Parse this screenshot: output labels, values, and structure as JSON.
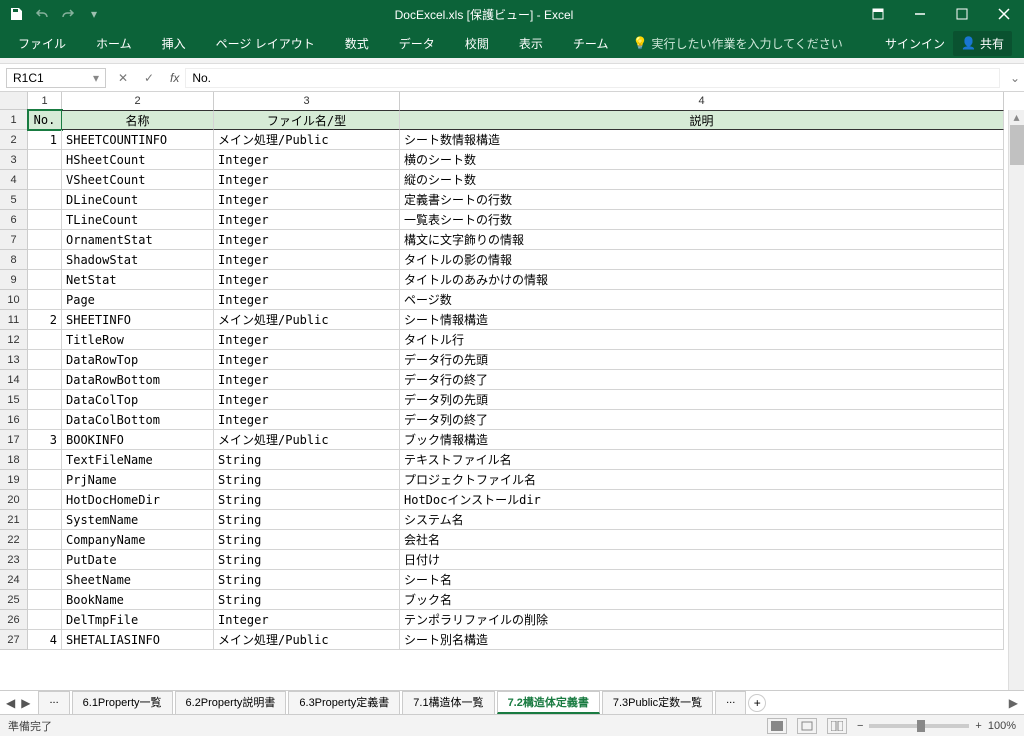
{
  "title": "DocExcel.xls [保護ビュー] - Excel",
  "qat": {
    "save": "save",
    "undo": "undo",
    "redo": "redo"
  },
  "win": {
    "ribbonOpts": "ribbon-options"
  },
  "tabs": [
    "ファイル",
    "ホーム",
    "挿入",
    "ページ レイアウト",
    "数式",
    "データ",
    "校閲",
    "表示",
    "チーム"
  ],
  "tellMe": "実行したい作業を入力してください",
  "signin": "サインイン",
  "share": "共有",
  "nameBox": "R1C1",
  "formulaValue": "No.",
  "colNums": [
    "1",
    "2",
    "3",
    "4"
  ],
  "headers": {
    "no": "No.",
    "name": "名称",
    "file": "ファイル名/型",
    "desc": "説明"
  },
  "rows": [
    {
      "r": "1"
    },
    {
      "r": "2",
      "no": "1",
      "name": "SHEETCOUNTINFO",
      "file": "メイン処理/Public",
      "desc": "シート数情報構造"
    },
    {
      "r": "3",
      "name": "HSheetCount",
      "file": "Integer",
      "desc": "横のシート数"
    },
    {
      "r": "4",
      "name": "VSheetCount",
      "file": "Integer",
      "desc": "縦のシート数"
    },
    {
      "r": "5",
      "name": "DLineCount",
      "file": "Integer",
      "desc": "定義書シートの行数"
    },
    {
      "r": "6",
      "name": "TLineCount",
      "file": "Integer",
      "desc": "一覧表シートの行数"
    },
    {
      "r": "7",
      "name": "OrnamentStat",
      "file": "Integer",
      "desc": "構文に文字飾りの情報"
    },
    {
      "r": "8",
      "name": "ShadowStat",
      "file": "Integer",
      "desc": "タイトルの影の情報"
    },
    {
      "r": "9",
      "name": "NetStat",
      "file": "Integer",
      "desc": "タイトルのあみかけの情報"
    },
    {
      "r": "10",
      "name": "Page",
      "file": "Integer",
      "desc": "ページ数"
    },
    {
      "r": "11",
      "no": "2",
      "name": "SHEETINFO",
      "file": "メイン処理/Public",
      "desc": "シート情報構造"
    },
    {
      "r": "12",
      "name": "TitleRow",
      "file": "Integer",
      "desc": "タイトル行"
    },
    {
      "r": "13",
      "name": "DataRowTop",
      "file": "Integer",
      "desc": "データ行の先頭"
    },
    {
      "r": "14",
      "name": "DataRowBottom",
      "file": "Integer",
      "desc": "データ行の終了"
    },
    {
      "r": "15",
      "name": "DataColTop",
      "file": "Integer",
      "desc": "データ列の先頭"
    },
    {
      "r": "16",
      "name": "DataColBottom",
      "file": "Integer",
      "desc": "データ列の終了"
    },
    {
      "r": "17",
      "no": "3",
      "name": "BOOKINFO",
      "file": "メイン処理/Public",
      "desc": "ブック情報構造"
    },
    {
      "r": "18",
      "name": "TextFileName",
      "file": "String",
      "desc": "テキストファイル名"
    },
    {
      "r": "19",
      "name": "PrjName",
      "file": "String",
      "desc": "プロジェクトファイル名"
    },
    {
      "r": "20",
      "name": "HotDocHomeDir",
      "file": "String",
      "desc": "HotDocインストールdir"
    },
    {
      "r": "21",
      "name": "SystemName",
      "file": "String",
      "desc": "システム名"
    },
    {
      "r": "22",
      "name": "CompanyName",
      "file": "String",
      "desc": "会社名"
    },
    {
      "r": "23",
      "name": "PutDate",
      "file": "String",
      "desc": "日付け"
    },
    {
      "r": "24",
      "name": "SheetName",
      "file": "String",
      "desc": "シート名"
    },
    {
      "r": "25",
      "name": "BookName",
      "file": "String",
      "desc": "ブック名"
    },
    {
      "r": "26",
      "name": "DelTmpFile",
      "file": "Integer",
      "desc": "テンポラリファイルの削除"
    },
    {
      "r": "27",
      "no": "4",
      "name": "SHETALIASINFO",
      "file": "メイン処理/Public",
      "desc": "シート別名構造"
    }
  ],
  "sheetTabs": [
    "...",
    "6.1Property一覧",
    "6.2Property説明書",
    "6.3Property定義書",
    "7.1構造体一覧",
    "7.2構造体定義書",
    "7.3Public定数一覧",
    "..."
  ],
  "activeTab": "7.2構造体定義書",
  "status": "準備完了",
  "zoom": "100%"
}
